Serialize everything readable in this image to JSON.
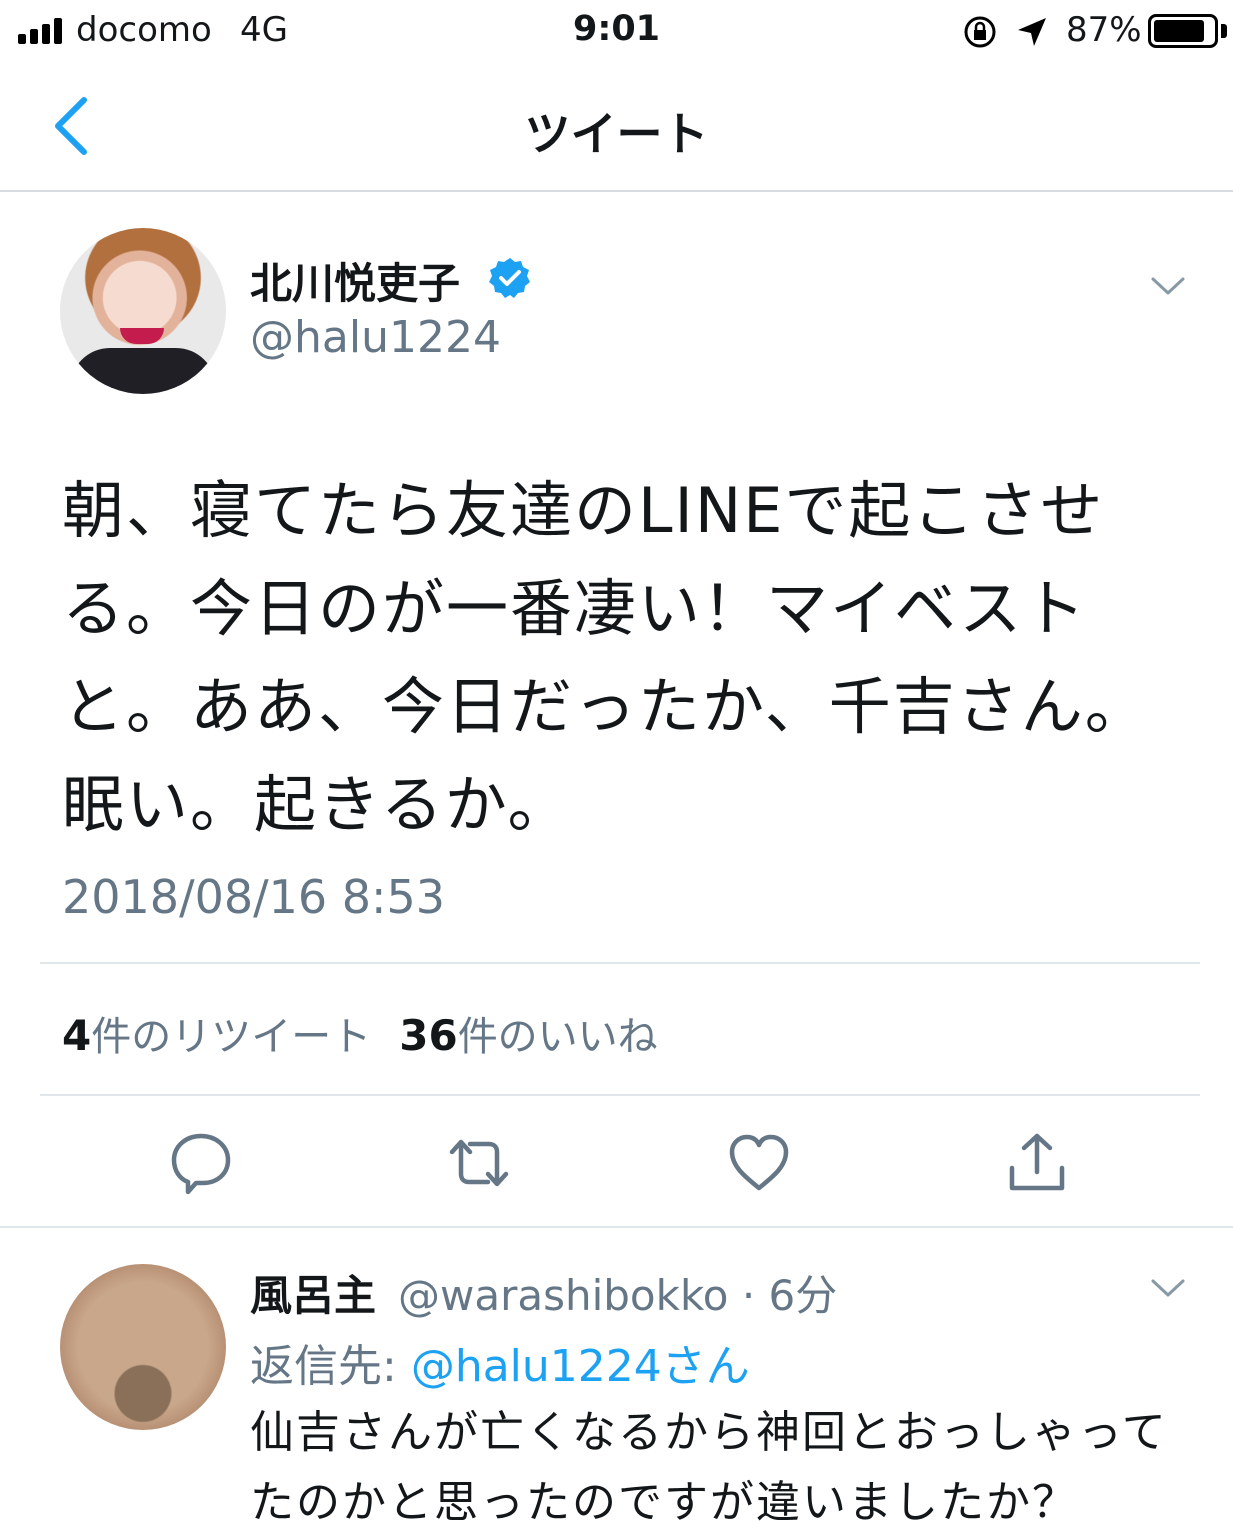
{
  "status_bar": {
    "carrier": "docomo",
    "network": "4G",
    "time": "9:01",
    "battery": "87%",
    "battery_level": 0.87
  },
  "nav": {
    "title": "ツイート"
  },
  "tweet": {
    "display_name": "北川悦吏子",
    "handle": "@halu1224",
    "text": "朝、寝てたら友達のLINEで起こさせる。今日のが一番凄い！マイベストと。ああ、今日だったか、千吉さん。眠い。起きるか。",
    "timestamp": "2018/08/16 8:53",
    "retweet_count": "4",
    "retweet_label": "件のリツイート",
    "like_count": "36",
    "like_label": "件のいいね"
  },
  "reply": {
    "display_name": "風呂主",
    "handle_time": "@warashibokko · 6分",
    "reply_to_label": "返信先: ",
    "reply_to_mention": "@halu1224さん",
    "text": "仙吉さんが亡くなるから神回とおっしゃってたのかと思ったのですが違いましたか？"
  },
  "colors": {
    "accent": "#1da1f2",
    "secondary_text": "#657786",
    "icon_gray": "#657786"
  },
  "icons": [
    "signal-icon",
    "orientation-lock-icon",
    "location-arrow-icon",
    "battery-icon",
    "back-chevron-icon",
    "verified-badge-icon",
    "chevron-down-icon",
    "reply-icon",
    "retweet-icon",
    "heart-icon",
    "share-icon"
  ]
}
